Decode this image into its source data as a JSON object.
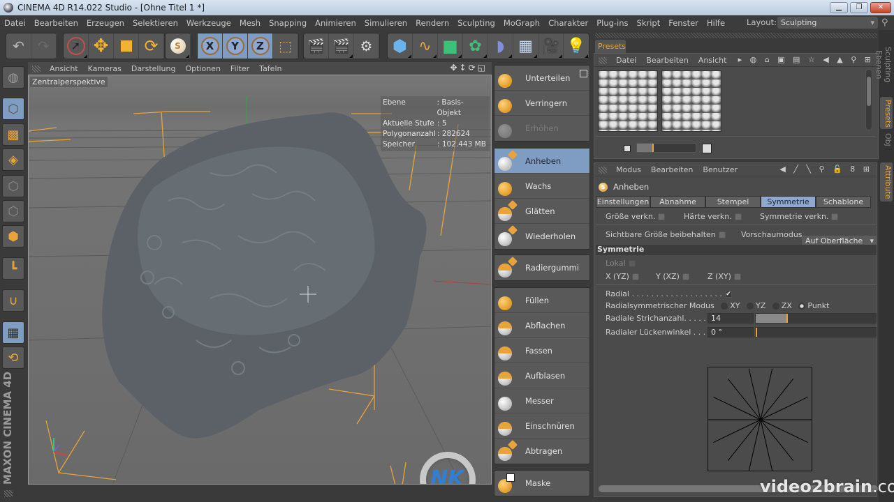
{
  "window": {
    "title": "CINEMA 4D R14.022 Studio - [Ohne Titel 1 *]",
    "controls": [
      "minimize",
      "restore",
      "close"
    ]
  },
  "menubar": {
    "items": [
      "Datei",
      "Bearbeiten",
      "Erzeugen",
      "Selektieren",
      "Werkzeuge",
      "Mesh",
      "Snapping",
      "Animieren",
      "Simulieren",
      "Rendern",
      "Sculpting",
      "MoGraph",
      "Charakter",
      "Plug-ins",
      "Skript",
      "Fenster",
      "Hilfe"
    ],
    "layout_label": "Layout:",
    "layout_value": "Sculpting"
  },
  "toolbar": {
    "groups": [
      {
        "icons": [
          "undo-icon",
          "redo-icon"
        ]
      },
      {
        "icons": [
          "live-selection-icon",
          "move-icon",
          "scale-icon",
          "rotate-icon"
        ]
      },
      {
        "icons": [
          "sculpt-brush-icon"
        ]
      },
      {
        "icons": [
          "x-axis-lock-icon",
          "y-axis-lock-icon",
          "z-axis-lock-icon",
          "coordinate-system-icon"
        ]
      },
      {
        "icons": [
          "render-view-icon",
          "render-picture-viewer-icon",
          "render-settings-icon"
        ]
      },
      {
        "icons": [
          "cube-icon",
          "spline-pen-icon",
          "nurbs-icon",
          "cloner-icon",
          "deformer-icon",
          "floor-icon",
          "camera-icon",
          "light-icon"
        ]
      }
    ],
    "axis_labels": [
      "X",
      "Y",
      "Z"
    ]
  },
  "viewport": {
    "menu": [
      "Ansicht",
      "Kameras",
      "Darstellung",
      "Optionen",
      "Filter",
      "Tafeln"
    ],
    "camera_label": "Zentralperspektive",
    "hud": [
      {
        "key": "Ebene",
        "value": ": Basis-Objekt"
      },
      {
        "key": "Aktuelle Stufe",
        "value": ": 5"
      },
      {
        "key": "Polygonanzahl",
        "value": ": 282624"
      },
      {
        "key": "Speicher",
        "value": ": 102.443 MB"
      }
    ],
    "brand_logo": "MAXON CINEMA 4D"
  },
  "brushes": {
    "groups": [
      [
        {
          "label": "Unterteilen",
          "state": "normal"
        },
        {
          "label": "Verringern",
          "state": "normal"
        },
        {
          "label": "Erhöhen",
          "state": "disabled"
        }
      ],
      [
        {
          "label": "Anheben",
          "state": "selected"
        },
        {
          "label": "Wachs",
          "state": "normal"
        },
        {
          "label": "Glätten",
          "state": "normal"
        },
        {
          "label": "Wiederholen",
          "state": "normal"
        }
      ],
      [
        {
          "label": "Radiergummi",
          "state": "normal"
        }
      ],
      [
        {
          "label": "Füllen",
          "state": "normal"
        },
        {
          "label": "Abflachen",
          "state": "normal"
        },
        {
          "label": "Fassen",
          "state": "normal"
        },
        {
          "label": "Aufblasen",
          "state": "normal"
        },
        {
          "label": "Messer",
          "state": "normal"
        },
        {
          "label": "Einschnüren",
          "state": "normal"
        },
        {
          "label": "Abtragen",
          "state": "normal"
        }
      ],
      [
        {
          "label": "Maske",
          "state": "normal"
        }
      ]
    ]
  },
  "presets": {
    "tab": "Presets",
    "menu": [
      "Datei",
      "Bearbeiten",
      "Ansicht"
    ],
    "thumbnails": [
      "stamp-preset-1",
      "stamp-preset-2"
    ],
    "thumb_size_fraction": 0.28
  },
  "attributes": {
    "menu": [
      "Modus",
      "Bearbeiten",
      "Benutzer"
    ],
    "tool_name": "Anheben",
    "tabs": [
      "Einstellungen",
      "Abnahme",
      "Stempel",
      "Symmetrie",
      "Schablone"
    ],
    "active_tab": "Symmetrie",
    "link_options": [
      {
        "label": "Größe verkn.",
        "checked": false
      },
      {
        "label": "Härte verkn.",
        "checked": false
      },
      {
        "label": "Symmetrie verkn.",
        "checked": false
      }
    ],
    "keep_visible_size": {
      "label": "Sichtbare Größe beibehalten",
      "checked": false
    },
    "preview_mode": {
      "label": "Vorschaumodus",
      "value": "Auf Oberfläche"
    },
    "section": "Symmetrie",
    "local": {
      "label": "Lokal",
      "checked": false
    },
    "axes": [
      {
        "label": "X (YZ)",
        "checked": false
      },
      {
        "label": "Y (XZ)",
        "checked": false
      },
      {
        "label": "Z (XY)",
        "checked": false
      }
    ],
    "radial": {
      "label": "Radial . . . . . . . . . . . . . . . . . . .",
      "checked": true
    },
    "radial_mode": {
      "label": "Radialsymmetrischer Modus",
      "options": [
        "XY",
        "YZ",
        "ZX",
        "Punkt"
      ],
      "selected": "Punkt"
    },
    "stroke_count": {
      "label": "Radiale Strichanzahl. . . . . . .",
      "value": "14",
      "slider_fraction": 0.27
    },
    "gap_angle": {
      "label": "Radialer Lückenwinkel . . . . .",
      "value": "0 °",
      "slider_fraction": 0.0
    },
    "preview_rays": 14
  },
  "side_tabs": [
    "Sculpting Ebenen",
    "Presets",
    "Obj",
    "Attribute"
  ],
  "watermark": {
    "main": "video2brain",
    "suffix": ".com"
  }
}
